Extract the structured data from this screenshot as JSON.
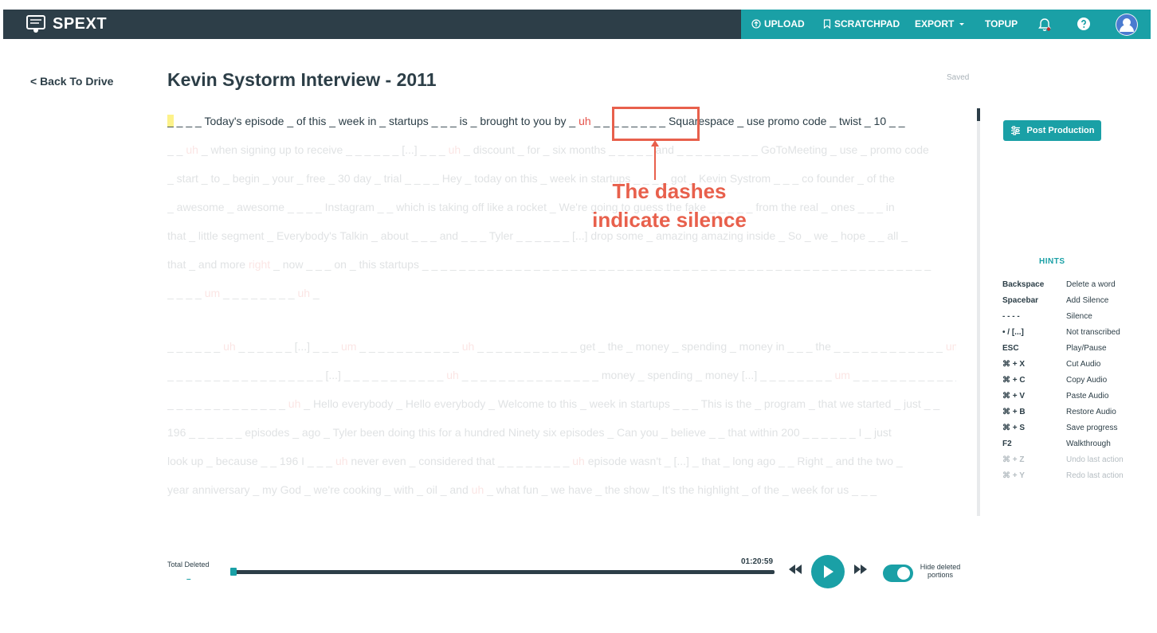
{
  "header": {
    "brand": "SPEXT",
    "upload": "UPLOAD",
    "scratchpad": "SCRATCHPAD",
    "export": "EXPORT",
    "topup": "TOPUP"
  },
  "back_link": "< Back To Drive",
  "document": {
    "title": "Kevin Systorm Interview - 2011",
    "status": "Saved"
  },
  "transcript": {
    "lines": [
      {
        "parts": [
          {
            "t": "_ _ _ _ Today's episode _ of this _ week in _ startups _ _ _ is _ brought to you by _ "
          },
          {
            "t": "uh",
            "uh": true
          },
          {
            "t": " _ _ _ _ _ _ _ _ Squarespace _ use promo code _ twist _ 10 _ _"
          }
        ]
      },
      {
        "parts": [
          {
            "t": "_ _ "
          },
          {
            "t": "uh",
            "uh": true
          },
          {
            "t": " _ when signing up to receive _ _ _ _ _ _ [...] _ _ _ "
          },
          {
            "t": "uh",
            "uh": true
          },
          {
            "t": " _ discount _ for _ six months _ _ _ _ _ and _ _ _ _ _ _ _ _ _ GoToMeeting _ use _ promo code"
          }
        ]
      },
      {
        "parts": [
          {
            "t": "_ start _ to _ begin _ your _ free _ 30 day _ trial _ _ _ _ Hey _ today on this _ week in startups _ _ _ _ got _ Kevin Systrom _ _ _ co founder _ of the"
          }
        ]
      },
      {
        "parts": [
          {
            "t": "_ awesome _ awesome _ _ _ _ Instagram _ _ which is taking off like a rocket _ We're going to guess the fake _ _ _ _ _ from the real _ ones _ _ _ in"
          }
        ]
      },
      {
        "parts": [
          {
            "t": "that _ little segment _ Everybody's Talkin _ about _ _ _ and _ _ _ Tyler _ _ _ _ _ _ [...] drop some _ amazing amazing inside _ So _ we _ hope _ _ all _"
          }
        ]
      },
      {
        "parts": [
          {
            "t": "that _ and more "
          },
          {
            "t": "right",
            "uh": true
          },
          {
            "t": " _ now _ _ _ on _ this startups _ _ _ _ _ _ _ _ _ _ _ _ _ _ _ _ _ _ _ _ _ _ _ _ _ _ _ _ _ _ _ _ _ _ _ _ _ _ _ _ _ _ _ _ _ _ _ _ _ _ _ _ _ _ _"
          }
        ]
      },
      {
        "parts": [
          {
            "t": "_ _ _ _ "
          },
          {
            "t": "um",
            "uh": true
          },
          {
            "t": " _ _ _ _ _ _ _ _ "
          },
          {
            "t": "uh",
            "uh": true
          },
          {
            "t": " _"
          }
        ]
      },
      {
        "parts": [
          {
            "t": "_ _ _ _ _ _ "
          },
          {
            "t": "uh",
            "uh": true
          },
          {
            "t": " _ _ _ _ _ _ [...] _ _ _ "
          },
          {
            "t": "um",
            "uh": true
          },
          {
            "t": " _ _ _ _ _ _ _ _ _ _ _ "
          },
          {
            "t": "uh",
            "uh": true
          },
          {
            "t": " _ _ _ _ _ _ _ _ _ _ _ get _ the _ money _ spending _ money in _ _ _ the _ _ _ _ _ _ _ _ _ _ _ _ "
          },
          {
            "t": "um",
            "uh": true
          }
        ]
      },
      {
        "parts": [
          {
            "t": "_ _ _ _ _ _ _ _ _ _ _ _ _ _ _ _ _ [...] _ _ _ _ _ _ _ _ _ _ _ "
          },
          {
            "t": "uh",
            "uh": true
          },
          {
            "t": " _ _ _ _ _ _ _ _ _ _ _ _ _ _ _ money _ spending _ money [...] _ _ _ _ _ _ _ _ "
          },
          {
            "t": "um",
            "uh": true
          },
          {
            "t": " _ _ _ _ _ _ _ _ _ _ _ _ _ _ _"
          }
        ]
      },
      {
        "parts": [
          {
            "t": "_ _ _ _ _ _ _ _ _ _ _ _ _ "
          },
          {
            "t": "uh",
            "uh": true
          },
          {
            "t": " _ Hello everybody _ Hello everybody _ Welcome to this _ week in startups _ _ _ This is the _ program _ that we started _ just _ _"
          }
        ]
      },
      {
        "parts": [
          {
            "t": "196 _ _ _ _ _ _ episodes _ ago _ Tyler been doing this for a hundred Ninety six episodes _ Can you _ believe _ _ that within 200 _ _ _ _ _ _ I _ just"
          }
        ]
      },
      {
        "parts": [
          {
            "t": "look up _ because _ _ 196 I _ _ _ "
          },
          {
            "t": "uh",
            "uh": true
          },
          {
            "t": " never even _ considered that _ _ _ _ _ _ _ _ "
          },
          {
            "t": "uh",
            "uh": true
          },
          {
            "t": " episode wasn't _ [...] _ that _ long ago _ _ Right _ and the two _"
          }
        ]
      },
      {
        "parts": [
          {
            "t": "year anniversary _ my God _ we're cooking _ with _ oil _ and "
          },
          {
            "t": "uh",
            "uh": true
          },
          {
            "t": " _ what fun _ we have _ the show _ It's the highlight _ of the _ week for us _ _ _"
          }
        ]
      }
    ]
  },
  "annotation": {
    "line1": "The dashes",
    "line2": "indicate silence"
  },
  "post_production": "Post Production",
  "hints": {
    "title": "HINTS",
    "rows": [
      {
        "key": "Backspace",
        "desc": "Delete a word",
        "dim": false
      },
      {
        "key": "Spacebar",
        "desc": "Add Silence",
        "dim": false
      },
      {
        "key": "- - - -",
        "desc": "Silence",
        "dim": false
      },
      {
        "key": "• / [...]",
        "desc": "Not transcribed",
        "dim": false
      },
      {
        "key": "ESC",
        "desc": "Play/Pause",
        "dim": false
      },
      {
        "key": "⌘ + X",
        "desc": "Cut Audio",
        "dim": false
      },
      {
        "key": "⌘ + C",
        "desc": "Copy Audio",
        "dim": false
      },
      {
        "key": "⌘ + V",
        "desc": "Paste Audio",
        "dim": false
      },
      {
        "key": "⌘ + B",
        "desc": "Restore Audio",
        "dim": false
      },
      {
        "key": "⌘ + S",
        "desc": "Save progress",
        "dim": false
      },
      {
        "key": "F2",
        "desc": "Walkthrough",
        "dim": false
      },
      {
        "key": "⌘ + Z",
        "desc": "Undo last action",
        "dim": true
      },
      {
        "key": "⌘ + Y",
        "desc": "Redo last action",
        "dim": true
      }
    ]
  },
  "player": {
    "total_deleted_label": "Total Deleted",
    "total_deleted_value": "–",
    "time": "01:20:59",
    "progress": 0.0,
    "hide_deleted_label": "Hide deleted portions",
    "hide_deleted_on": true
  },
  "colors": {
    "header_dark": "#2d3e48",
    "accent_teal": "#1aa0a6",
    "filler_red": "#e5534b",
    "annotation": "#e8604c"
  }
}
